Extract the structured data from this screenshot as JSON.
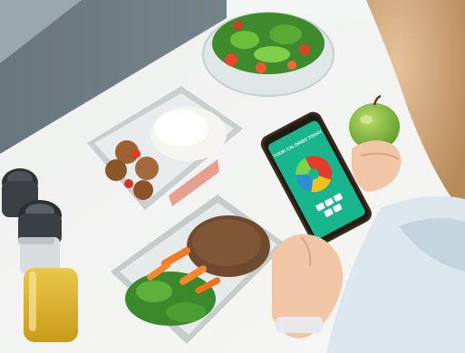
{
  "photo": {
    "subject": "food-tracking-app-photo"
  },
  "app_screen": {
    "title": "YOUR CALORIES TODAY",
    "subtitle": "",
    "pie_slices": [
      0.38,
      0.22,
      0.22,
      0.18
    ],
    "colors": {
      "screen": "#19b58c",
      "slice_a": "#e63b2b",
      "slice_b": "#f5c21b",
      "slice_c": "#2b8fd8",
      "slice_d": "#7bd44a"
    }
  }
}
